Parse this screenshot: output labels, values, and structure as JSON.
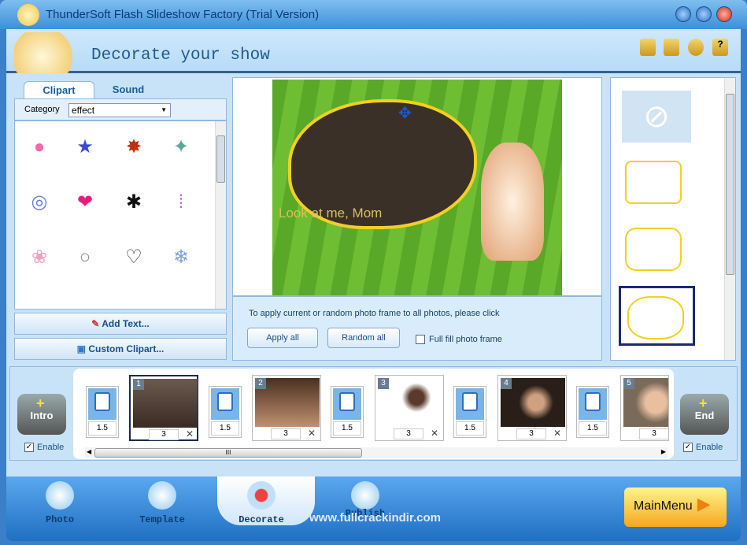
{
  "window": {
    "title": "ThunderSoft Flash Slideshow Factory (Trial Version)"
  },
  "header": {
    "title": "Decorate your show"
  },
  "left_panel": {
    "tabs": [
      {
        "label": "Clipart",
        "active": true
      },
      {
        "label": "Sound",
        "active": false
      }
    ],
    "category_label": "Category",
    "category_value": "effect",
    "add_text": "Add Text...",
    "custom_clipart": "Custom Clipart..."
  },
  "preview": {
    "overlay_text": "Look at me, Mom"
  },
  "controls": {
    "note": "To apply current or random photo frame  to all photos, please click",
    "apply_all": "Apply all",
    "random_all": "Random all",
    "full_fill": "Full fill photo frame",
    "full_fill_checked": false
  },
  "timeline": {
    "intro": "Intro",
    "end": "End",
    "enable": "Enable",
    "intro_enabled": true,
    "end_enabled": true,
    "photos": [
      {
        "num": "1",
        "dur": "3"
      },
      {
        "num": "2",
        "dur": "3"
      },
      {
        "num": "3",
        "dur": "3"
      },
      {
        "num": "4",
        "dur": "3"
      },
      {
        "num": "5",
        "dur": "3"
      }
    ],
    "transitions": [
      {
        "dur": "1.5"
      },
      {
        "dur": "1.5"
      },
      {
        "dur": "1.5"
      },
      {
        "dur": "1.5"
      },
      {
        "dur": "1.5"
      }
    ],
    "scroll_grip": "III"
  },
  "nav": {
    "items": [
      {
        "label": "Photo"
      },
      {
        "label": "Template"
      },
      {
        "label": "Decorate",
        "active": true
      },
      {
        "label": "Publish"
      }
    ],
    "main_menu": "MainMenu"
  },
  "watermark": "www.fullcrackindir.com"
}
